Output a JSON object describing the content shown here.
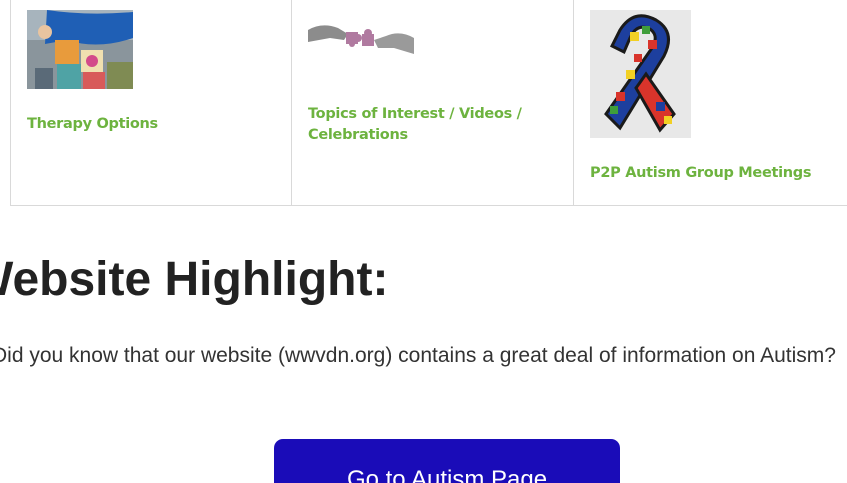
{
  "cards": [
    {
      "title": "Therapy Options",
      "icon": "therapy-photo"
    },
    {
      "title": "Topics of Interest / Videos / Celebrations",
      "icon": "puzzle-hands-photo"
    },
    {
      "title": "P2P Autism Group Meetings",
      "icon": "autism-ribbon"
    }
  ],
  "highlight": {
    "title": "Website Highlight:",
    "text": "Did you know that our website (wwvdn.org) contains a great deal of information on Autism?"
  },
  "cta": {
    "label": "Go to Autism Page"
  },
  "colors": {
    "card_title": "#6db33f",
    "button": "#1a0cb8"
  }
}
